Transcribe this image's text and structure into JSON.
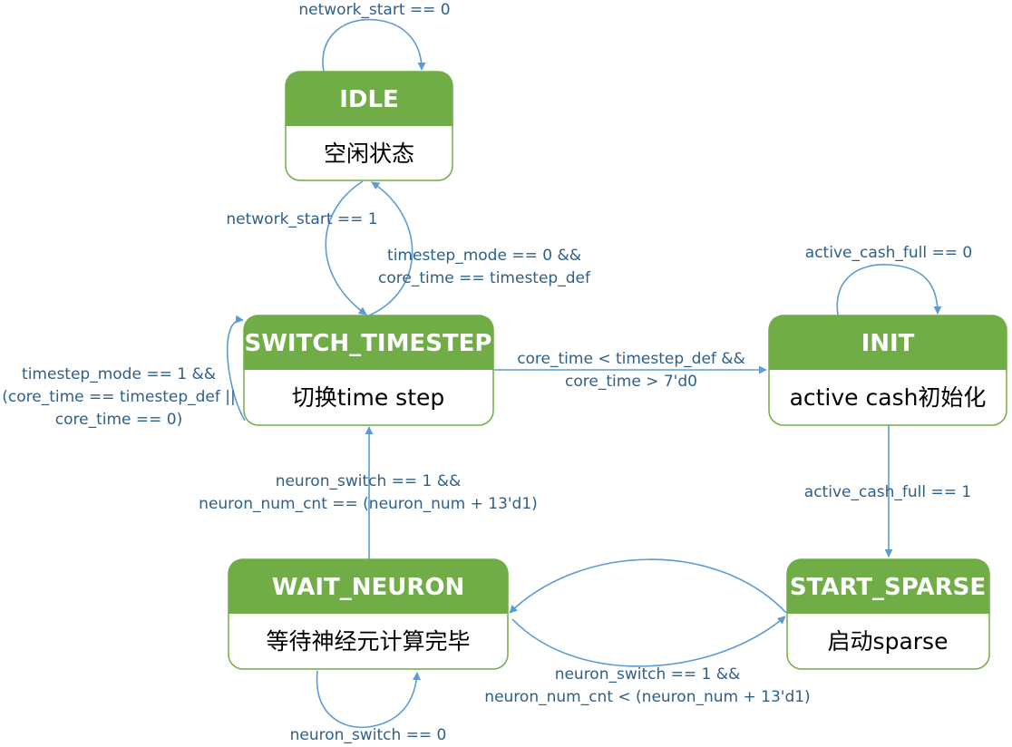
{
  "states": {
    "idle": {
      "title": "IDLE",
      "desc": "空闲状态"
    },
    "switch_timestep": {
      "title": "SWITCH_TIMESTEP",
      "desc": "切换time step"
    },
    "init": {
      "title": "INIT",
      "desc": "active cash初始化"
    },
    "wait_neuron": {
      "title": "WAIT_NEURON",
      "desc": "等待神经元计算完毕"
    },
    "start_sparse": {
      "title": "START_SPARSE",
      "desc": "启动sparse"
    }
  },
  "transitions": {
    "idle_self": [
      "network_start == 0"
    ],
    "idle_to_switch": [
      "network_start == 1"
    ],
    "switch_to_idle": [
      "timestep_mode == 0 &&",
      "core_time == timestep_def"
    ],
    "switch_self": [
      "timestep_mode == 1 &&",
      "(core_time == timestep_def ||",
      "core_time == 0)"
    ],
    "switch_to_init": [
      "core_time < timestep_def &&",
      "core_time > 7'd0"
    ],
    "init_self": [
      "active_cash_full == 0"
    ],
    "init_to_sparse": [
      "active_cash_full == 1"
    ],
    "wait_to_switch": [
      "neuron_switch == 1 &&",
      "neuron_num_cnt == (neuron_num + 13'd1)"
    ],
    "wait_sparse": [
      "neuron_switch == 1 &&",
      "neuron_num_cnt < (neuron_num + 13'd1)"
    ],
    "wait_self": [
      "neuron_switch == 0"
    ]
  },
  "colors": {
    "state_header": "#70ad47",
    "edge": "#5b9bd5",
    "edge_label": "#2e5f8a"
  }
}
